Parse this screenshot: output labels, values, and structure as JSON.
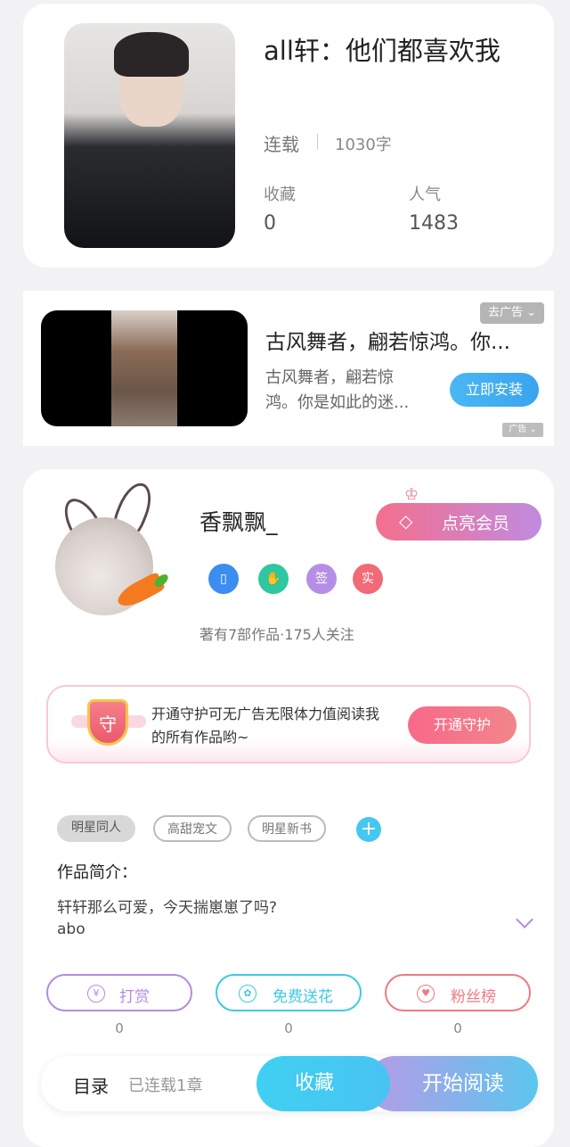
{
  "book": {
    "title": "all轩：他们都喜欢我",
    "status": "连载",
    "word_count": "1030字",
    "favorites_label": "收藏",
    "favorites_value": "0",
    "popularity_label": "人气",
    "popularity_value": "1483"
  },
  "ad": {
    "close_tag": "去广告 ⌄",
    "title": "古风舞者，翩若惊鸿。你...",
    "description": "古风舞者，翩若惊鸿。你是如此的迷...",
    "install_button": "立即安装",
    "ad_label": "广告 ⌄"
  },
  "author": {
    "name": "香飘飘_",
    "vip_button": "点亮会员",
    "badges": [
      {
        "icon": "phone-badge-icon",
        "text": "",
        "color": "#3b8ef0"
      },
      {
        "icon": "handshake-badge-icon",
        "text": "",
        "color": "#2fc7a0"
      },
      {
        "icon": "sign-badge-icon",
        "text": "签",
        "color": "#b68ee6"
      },
      {
        "icon": "verified-badge-icon",
        "text": "实",
        "color": "#f06a78"
      }
    ],
    "meta": "著有7部作品·175人关注"
  },
  "guard": {
    "icon_text": "守",
    "text": "开通守护可无广告无限体力值阅读我的所有作品哟~",
    "button": "开通守护"
  },
  "tags": [
    "明星同人",
    "高甜宠文",
    "明星新书"
  ],
  "intro": {
    "label": "作品简介：",
    "line1": "轩轩那么可爱，今天揣崽崽了吗?",
    "line2": "abo"
  },
  "actions": [
    {
      "label": "打赏",
      "icon": "yen-icon",
      "count": "0",
      "color": "#b48be0"
    },
    {
      "label": "免费送花",
      "icon": "flower-icon",
      "count": "0",
      "color": "#3fc9e3"
    },
    {
      "label": "粉丝榜",
      "icon": "fan-user-icon",
      "count": "0",
      "color": "#ef7a80"
    }
  ],
  "bottom_bar": {
    "catalog": "目录",
    "chapters": "已连载1章",
    "favorite_button": "收藏",
    "read_button": "开始阅读"
  }
}
